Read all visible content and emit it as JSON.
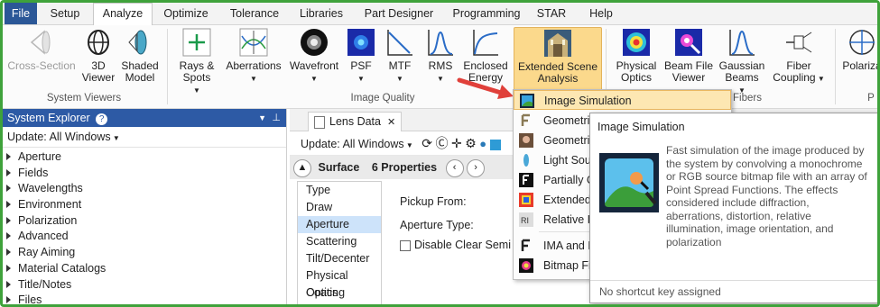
{
  "menubar": {
    "tabs": [
      "File",
      "Setup",
      "Analyze",
      "Optimize",
      "Tolerance",
      "Libraries",
      "Part Designer",
      "Programming",
      "STAR",
      "Help"
    ],
    "active": "Analyze"
  },
  "ribbon": {
    "system_viewers": {
      "label": "System Viewers",
      "buttons": [
        {
          "label": "Cross-Section",
          "icon": "cross-section-icon",
          "disabled": true
        },
        {
          "label": "3D Viewer",
          "icon": "3d-viewer-icon"
        },
        {
          "label": "Shaded Model",
          "icon": "shaded-model-icon"
        }
      ]
    },
    "image_quality": {
      "label": "Image Quality",
      "buttons": [
        {
          "label": "Rays & Spots",
          "icon": "spot-diagram-icon"
        },
        {
          "label": "Aberrations",
          "icon": "aberrations-icon"
        },
        {
          "label": "Wavefront",
          "icon": "wavefront-icon"
        },
        {
          "label": "PSF",
          "icon": "psf-icon"
        },
        {
          "label": "MTF",
          "icon": "mtf-icon"
        },
        {
          "label": "RMS",
          "icon": "rms-icon"
        },
        {
          "label": "Enclosed Energy",
          "icon": "enclosed-energy-icon"
        },
        {
          "label": "Extended Scene Analysis",
          "icon": "extended-scene-icon"
        }
      ]
    },
    "fibers": {
      "label": "Fibers",
      "buttons": [
        {
          "label": "Physical Optics",
          "icon": "physical-optics-icon"
        },
        {
          "label": "Beam File Viewer",
          "icon": "beam-file-viewer-icon"
        },
        {
          "label": "Gaussian Beams",
          "icon": "gaussian-beams-icon"
        },
        {
          "label": "Fiber Coupling",
          "icon": "fiber-coupling-icon"
        }
      ]
    },
    "polarization": {
      "label": "Polariza",
      "group_label": "P"
    }
  },
  "system_explorer": {
    "title": "System Explorer",
    "update": "Update: All Windows",
    "items": [
      "Aperture",
      "Fields",
      "Wavelengths",
      "Environment",
      "Polarization",
      "Advanced",
      "Ray Aiming",
      "Material Catalogs",
      "Title/Notes",
      "Files"
    ]
  },
  "lens_data": {
    "tab": "Lens Data",
    "update": "Update: All Windows",
    "surface_label": "Surface",
    "properties_label": "6 Properties",
    "props": [
      "Type",
      "Draw",
      "Aperture",
      "Scattering",
      "Tilt/Decenter",
      "Physical Optics",
      "Coating"
    ],
    "selected_prop": "Aperture",
    "pickup_label": "Pickup From:",
    "aperture_type_label": "Aperture Type:",
    "disable_checkbox_label": "Disable Clear Semi D"
  },
  "dropdown": {
    "items": [
      "Image Simulation",
      "Geometric",
      "Geometric",
      "Light Sour",
      "Partially C",
      "Extended",
      "Relative Ill",
      "IMA and B",
      "Bitmap Fil"
    ],
    "highlighted": "Image Simulation"
  },
  "tooltip": {
    "title": "Image Simulation",
    "description": "Fast simulation of the image produced by the system by convolving a monochrome or RGB source bitmap file with an array of Point Spread Functions. The effects considered include diffraction, aberrations, distortion, relative illumination, image orientation, and polarization",
    "footer": "No shortcut key assigned"
  },
  "colors": {
    "accent": "#2b5797",
    "frame": "#3fa23b",
    "highlight": "#fbd98c",
    "arrow": "#e0403a"
  }
}
